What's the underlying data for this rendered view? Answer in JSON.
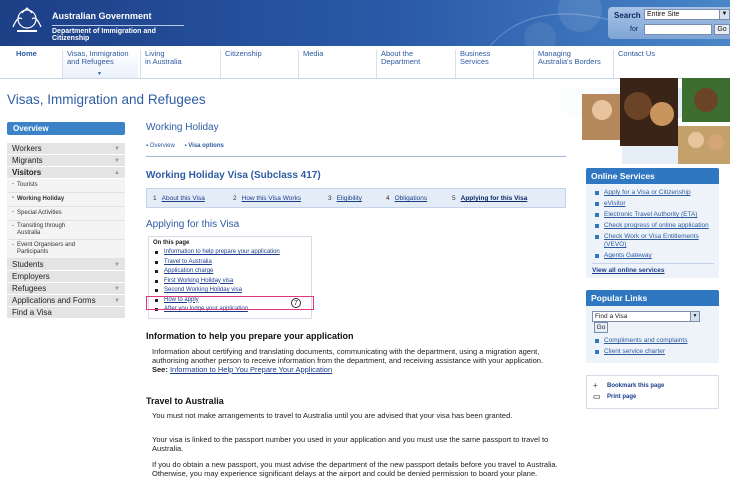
{
  "header": {
    "gov_line1": "Australian Government",
    "gov_line2": "Department of Immigration and Citizenship",
    "search_label": "Search",
    "search_scope": "Entire Site",
    "search_for_label": "for",
    "search_value": "",
    "search_go": "Go"
  },
  "nav": {
    "home": "Home",
    "visas_l1": "Visas, Immigration",
    "visas_l2": "and Refugees",
    "living_l1": "Living",
    "living_l2": "in Australia",
    "citizenship": "Citizenship",
    "media": "Media",
    "about_l1": "About the",
    "about_l2": "Department",
    "business_l1": "Business",
    "business_l2": "Services",
    "borders_l1": "Managing",
    "borders_l2": "Australia's Borders",
    "contact": "Contact Us"
  },
  "page_title": "Visas, Immigration and Refugees",
  "sidebar": {
    "overview": "Overview",
    "workers": "Workers",
    "migrants": "Migrants",
    "visitors": "Visitors",
    "sub_tourists": "Tourists",
    "sub_working_holiday": "Working Holiday",
    "sub_special": "Special Activities",
    "sub_transit_l1": "Transiting through",
    "sub_transit_l2": "Australia",
    "sub_event_l1": "Event Organisers and",
    "sub_event_l2": "Participants",
    "students": "Students",
    "employers": "Employers",
    "refugees": "Refugees",
    "applications": "Applications and Forms",
    "find_visa": "Find a Visa"
  },
  "main": {
    "heading": "Working Holiday",
    "subnav_overview": "Overview",
    "subnav_options": "Visa options",
    "visa_title": "Working Holiday Visa (Subclass 417)",
    "steps": [
      {
        "n": "1",
        "label": "About this Visa"
      },
      {
        "n": "2",
        "label": "How this Visa Works"
      },
      {
        "n": "3",
        "label": "Eligibility"
      },
      {
        "n": "4",
        "label": "Obligations"
      },
      {
        "n": "5",
        "label": "Applying for this Visa"
      }
    ],
    "apply_heading": "Applying for this Visa",
    "toc_title": "On this page",
    "toc": [
      "Information to help prepare your application",
      "Travel to Australia",
      "Application charge",
      "First Working Holiday visa",
      "Second Working Holiday visa",
      "How to apply",
      "After you lodge your application"
    ],
    "marker": "7",
    "sec1_title": "Information to help you prepare your application",
    "sec1_p1": "Information about certifying and translating documents, communicating with the department, using a migration agent, authorising another person to receive information from the department, and receiving assistance with your application.",
    "sec1_see": "See:",
    "sec1_link": "Information to Help You Prepare Your Application",
    "sec2_title": "Travel to Australia",
    "sec2_p1": "You must not make arrangements to travel to Australia until you are advised that your visa has been granted.",
    "sec2_p2": "Your visa is linked to the passport number you used in your application and you must use the same passport to travel to Australia.",
    "sec2_p3": "If you do obtain a new passport, you must advise the department of the new passport details before you travel to Australia. Otherwise, you may experience significant delays at the airport and could be denied permission to board your plane."
  },
  "right": {
    "online_title": "Online Services",
    "online_links": [
      "Apply for a Visa or Citizenship",
      "eVisitor",
      "Electronic Travel Authority (ETA)",
      "Check progress of online application",
      "Check Work or Visa Entitlements (VEVO)",
      "Agents Gateway"
    ],
    "online_all": "View all online services",
    "popular_title": "Popular Links",
    "popular_select": "Find a Visa",
    "popular_go": "Go",
    "popular_links": [
      "Compliments and complaints",
      "Client service charter"
    ],
    "bookmark": "Bookmark this page",
    "print": "Print page"
  }
}
